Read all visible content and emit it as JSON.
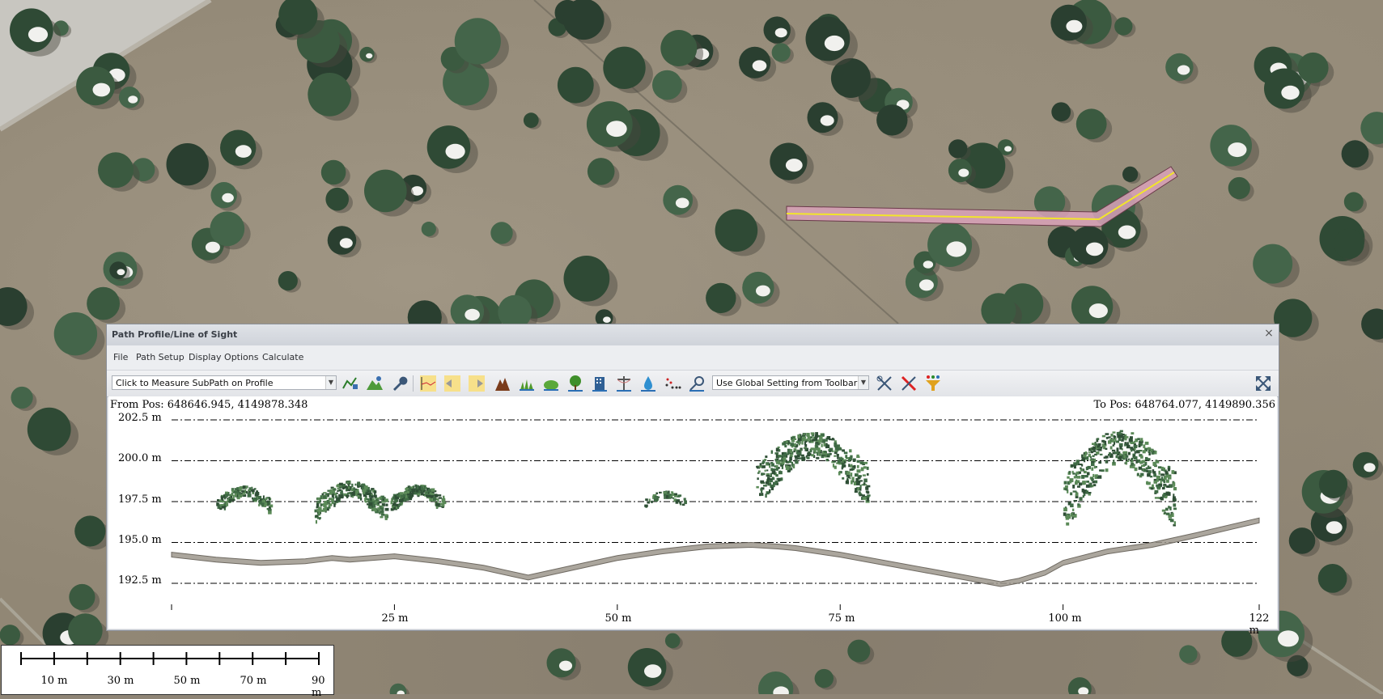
{
  "window": {
    "title": "Path Profile/Line of Sight",
    "close_icon": "×"
  },
  "menu": [
    "File",
    "Path Setup",
    "Display Options",
    "Calculate"
  ],
  "toolbar": {
    "measure_mode": "Click to Measure SubPath on Profile",
    "global_setting": "Use Global Setting from Toolbar",
    "icons": [
      "profile-settings-icon",
      "terrain-icon",
      "wrench-icon",
      "profile-line-icon",
      "shift-left-icon",
      "shift-right-icon",
      "ground-icon",
      "grass-icon",
      "bush-icon",
      "tree-icon",
      "building-icon",
      "powerline-icon",
      "water-icon",
      "points-icon",
      "measure-icon",
      "zoom-extents-icon"
    ]
  },
  "profile": {
    "from_pos": "From Pos: 648646.945, 4149878.348",
    "to_pos": "To Pos: 648764.077, 4149890.356",
    "y_ticks": [
      "202.5 m",
      "200.0 m",
      "197.5 m",
      "195.0 m",
      "192.5 m"
    ],
    "x_ticks": [
      "25 m",
      "50 m",
      "75 m",
      "100 m",
      "122 m"
    ]
  },
  "chart_data": {
    "type": "line",
    "title": "",
    "xlabel": "",
    "ylabel": "",
    "ylim": [
      191.5,
      203.0
    ],
    "xlim": [
      0,
      122
    ],
    "grid": true,
    "series": [
      {
        "x": [
          0,
          5,
          10,
          15,
          18,
          20,
          25,
          30,
          35,
          40,
          45,
          50,
          55,
          60,
          65,
          68,
          70,
          75,
          80,
          85,
          90,
          93,
          95,
          98,
          100,
          105,
          110,
          115,
          122
        ],
        "values": [
          194.4,
          194.1,
          193.9,
          194.0,
          194.2,
          194.1,
          194.3,
          194.0,
          193.6,
          193.0,
          193.6,
          194.2,
          194.6,
          194.9,
          195.0,
          194.9,
          194.8,
          194.4,
          193.9,
          193.4,
          192.9,
          192.6,
          192.8,
          193.3,
          193.9,
          194.6,
          195.0,
          195.6,
          196.5
        ]
      }
    ],
    "vegetation_colors": [
      "#3f6b45",
      "#5b8a58",
      "#2f4f36"
    ]
  },
  "scalebar": {
    "labels": [
      "10 m",
      "30 m",
      "50 m",
      "70 m",
      "90 m"
    ]
  }
}
